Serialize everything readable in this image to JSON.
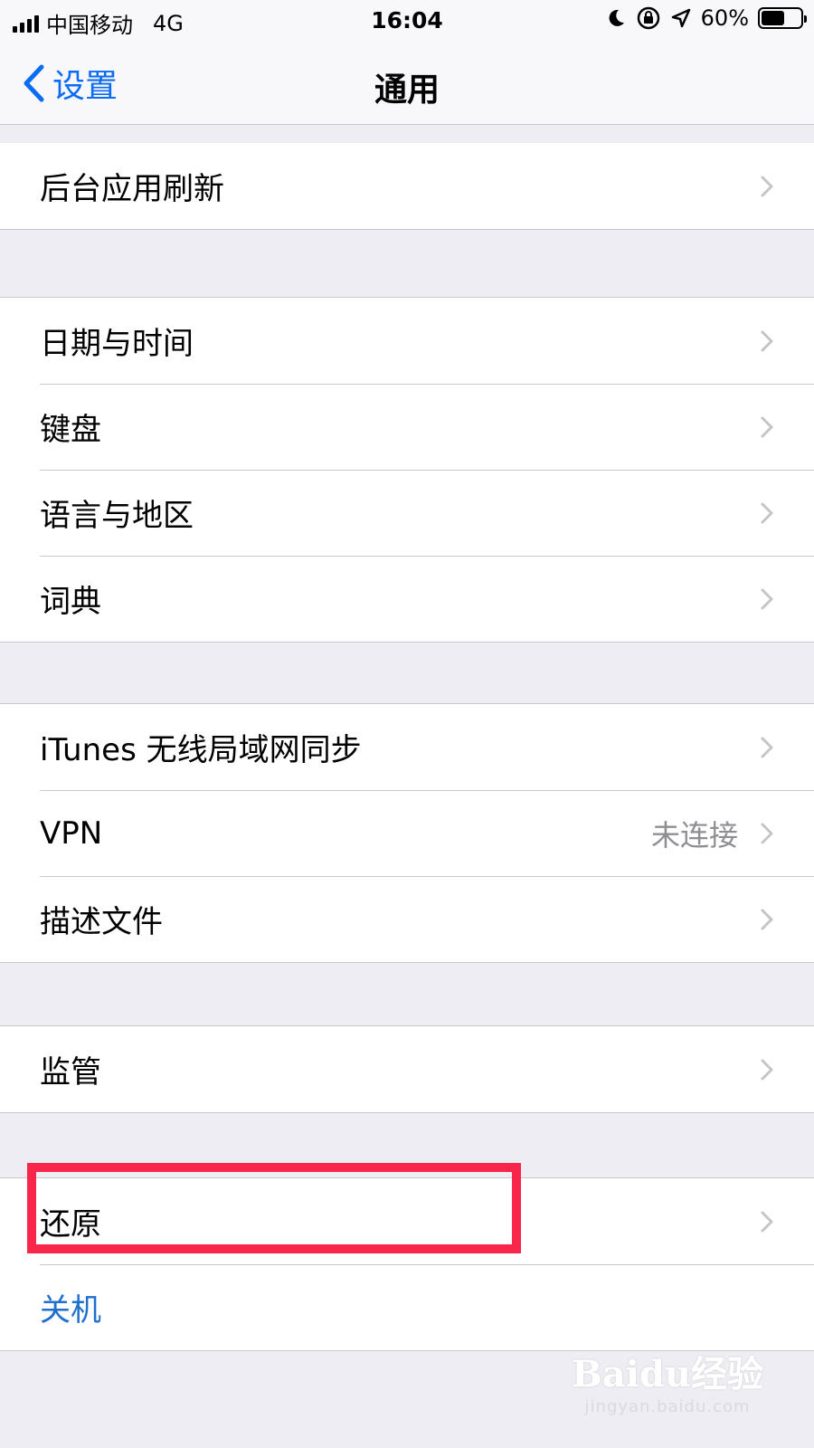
{
  "status_bar": {
    "carrier": "中国移动",
    "network": "4G",
    "time": "16:04",
    "battery_percent": "60%",
    "battery_level": 0.6,
    "icons": [
      "moon-icon",
      "rotation-lock-icon",
      "location-icon"
    ]
  },
  "nav": {
    "back_label": "设置",
    "title": "通用"
  },
  "groups": [
    {
      "rows": [
        {
          "label": "后台应用刷新"
        }
      ]
    },
    {
      "rows": [
        {
          "label": "日期与时间"
        },
        {
          "label": "键盘"
        },
        {
          "label": "语言与地区"
        },
        {
          "label": "词典"
        }
      ]
    },
    {
      "rows": [
        {
          "label": "iTunes 无线局域网同步"
        },
        {
          "label": "VPN",
          "value": "未连接"
        },
        {
          "label": "描述文件"
        }
      ]
    },
    {
      "rows": [
        {
          "label": "监管"
        }
      ]
    },
    {
      "rows": [
        {
          "label": "还原"
        },
        {
          "label": "关机"
        }
      ]
    }
  ],
  "watermark": {
    "logo": "Baidu经验",
    "url": "jingyan.baidu.com"
  },
  "colors": {
    "accent": "#0a6cf5",
    "highlight": "#f7264a",
    "background": "#efedf4"
  }
}
